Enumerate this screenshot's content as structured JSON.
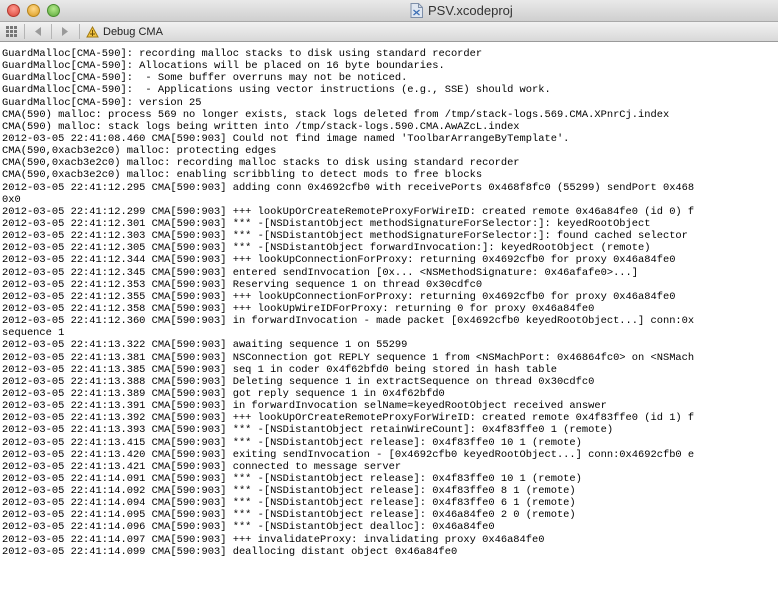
{
  "window": {
    "title": "PSV.xcodeproj"
  },
  "toolbar": {
    "grid_icon": "grid-icon",
    "back_icon": "back-arrow-icon",
    "forward_icon": "forward-arrow-icon",
    "scheme_icon": "target-scheme-icon",
    "jump_label": "Debug CMA"
  },
  "console": {
    "lines": [
      "GuardMalloc[CMA-590]: recording malloc stacks to disk using standard recorder",
      "GuardMalloc[CMA-590]: Allocations will be placed on 16 byte boundaries.",
      "GuardMalloc[CMA-590]:  - Some buffer overruns may not be noticed.",
      "GuardMalloc[CMA-590]:  - Applications using vector instructions (e.g., SSE) should work.",
      "GuardMalloc[CMA-590]: version 25",
      "CMA(590) malloc: process 569 no longer exists, stack logs deleted from /tmp/stack-logs.569.CMA.XPnrCj.index",
      "CMA(590) malloc: stack logs being written into /tmp/stack-logs.590.CMA.AwAZcL.index",
      "2012-03-05 22:41:08.460 CMA[590:903] Could not find image named 'ToolbarArrangeByTemplate'.",
      "CMA(590,0xacb3e2c0) malloc: protecting edges",
      "CMA(590,0xacb3e2c0) malloc: recording malloc stacks to disk using standard recorder",
      "CMA(590,0xacb3e2c0) malloc: enabling scribbling to detect mods to free blocks",
      "2012-03-05 22:41:12.295 CMA[590:903] adding conn 0x4692cfb0 with receivePorts 0x468f8fc0 (55299) sendPort 0x468",
      "0x0",
      "2012-03-05 22:41:12.299 CMA[590:903] +++ lookUpOrCreateRemoteProxyForWireID: created remote 0x46a84fe0 (id 0) f",
      "2012-03-05 22:41:12.301 CMA[590:903] *** -[NSDistantObject methodSignatureForSelector:]: keyedRootObject",
      "2012-03-05 22:41:12.303 CMA[590:903] *** -[NSDistantObject methodSignatureForSelector:]: found cached selector",
      "2012-03-05 22:41:12.305 CMA[590:903] *** -[NSDistantObject forwardInvocation:]: keyedRootObject (remote)",
      "2012-03-05 22:41:12.344 CMA[590:903] +++ lookUpConnectionForProxy: returning 0x4692cfb0 for proxy 0x46a84fe0",
      "2012-03-05 22:41:12.345 CMA[590:903] entered sendInvocation [0x... <NSMethodSignature: 0x46afafe0>...]",
      "2012-03-05 22:41:12.353 CMA[590:903] Reserving sequence 1 on thread 0x30cdfc0",
      "2012-03-05 22:41:12.355 CMA[590:903] +++ lookUpConnectionForProxy: returning 0x4692cfb0 for proxy 0x46a84fe0",
      "2012-03-05 22:41:12.358 CMA[590:903] +++ lookUpWireIDForProxy: returning 0 for proxy 0x46a84fe0",
      "2012-03-05 22:41:12.360 CMA[590:903] in forwardInvocation - made packet [0x4692cfb0 keyedRootObject...] conn:0x",
      "sequence 1",
      "2012-03-05 22:41:13.322 CMA[590:903] awaiting sequence 1 on 55299",
      "2012-03-05 22:41:13.381 CMA[590:903] NSConnection got REPLY sequence 1 from <NSMachPort: 0x46864fc0> on <NSMach",
      "2012-03-05 22:41:13.385 CMA[590:903] seq 1 in coder 0x4f62bfd0 being stored in hash table",
      "2012-03-05 22:41:13.388 CMA[590:903] Deleting sequence 1 in extractSequence on thread 0x30cdfc0",
      "2012-03-05 22:41:13.389 CMA[590:903] got reply sequence 1 in 0x4f62bfd0",
      "2012-03-05 22:41:13.391 CMA[590:903] in forwardInvocation selName=keyedRootObject received answer",
      "2012-03-05 22:41:13.392 CMA[590:903] +++ lookUpOrCreateRemoteProxyForWireID: created remote 0x4f83ffe0 (id 1) f",
      "2012-03-05 22:41:13.393 CMA[590:903] *** -[NSDistantObject retainWireCount]: 0x4f83ffe0 1 (remote)",
      "2012-03-05 22:41:13.415 CMA[590:903] *** -[NSDistantObject release]: 0x4f83ffe0 10 1 (remote)",
      "2012-03-05 22:41:13.420 CMA[590:903] exiting sendInvocation - [0x4692cfb0 keyedRootObject...] conn:0x4692cfb0 e",
      "2012-03-05 22:41:13.421 CMA[590:903] connected to message server",
      "2012-03-05 22:41:14.091 CMA[590:903] *** -[NSDistantObject release]: 0x4f83ffe0 10 1 (remote)",
      "2012-03-05 22:41:14.092 CMA[590:903] *** -[NSDistantObject release]: 0x4f83ffe0 8 1 (remote)",
      "2012-03-05 22:41:14.094 CMA[590:903] *** -[NSDistantObject release]: 0x4f83ffe0 6 1 (remote)",
      "2012-03-05 22:41:14.095 CMA[590:903] *** -[NSDistantObject release]: 0x46a84fe0 2 0 (remote)",
      "2012-03-05 22:41:14.096 CMA[590:903] *** -[NSDistantObject dealloc]: 0x46a84fe0",
      "2012-03-05 22:41:14.097 CMA[590:903] +++ invalidateProxy: invalidating proxy 0x46a84fe0",
      "2012-03-05 22:41:14.099 CMA[590:903] deallocing distant object 0x46a84fe0"
    ]
  }
}
